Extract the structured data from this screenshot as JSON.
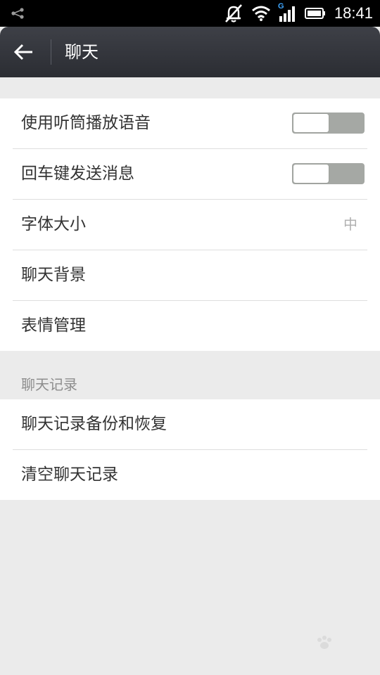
{
  "status_bar": {
    "time": "18:41",
    "network_label": "G",
    "icons": [
      "share-icon",
      "alarm-off-icon",
      "wifi-icon",
      "signal-icon",
      "battery-icon"
    ]
  },
  "appbar": {
    "back_icon": "back-arrow-icon",
    "title": "聊天"
  },
  "settings": {
    "general": [
      {
        "label": "使用听筒播放语音",
        "type": "toggle",
        "on": false
      },
      {
        "label": "回车键发送消息",
        "type": "toggle",
        "on": false
      },
      {
        "label": "字体大小",
        "type": "value",
        "value": "中"
      },
      {
        "label": "聊天背景",
        "type": "link"
      },
      {
        "label": "表情管理",
        "type": "link"
      }
    ],
    "history_header": "聊天记录",
    "history": [
      {
        "label": "聊天记录备份和恢复",
        "type": "link"
      },
      {
        "label": "清空聊天记录",
        "type": "link"
      }
    ]
  },
  "colors": {
    "background": "#ebebeb",
    "appbar": "#2f3137",
    "toggle_off_track": "#a5a8a4",
    "section_header": "#8d8d8d"
  }
}
